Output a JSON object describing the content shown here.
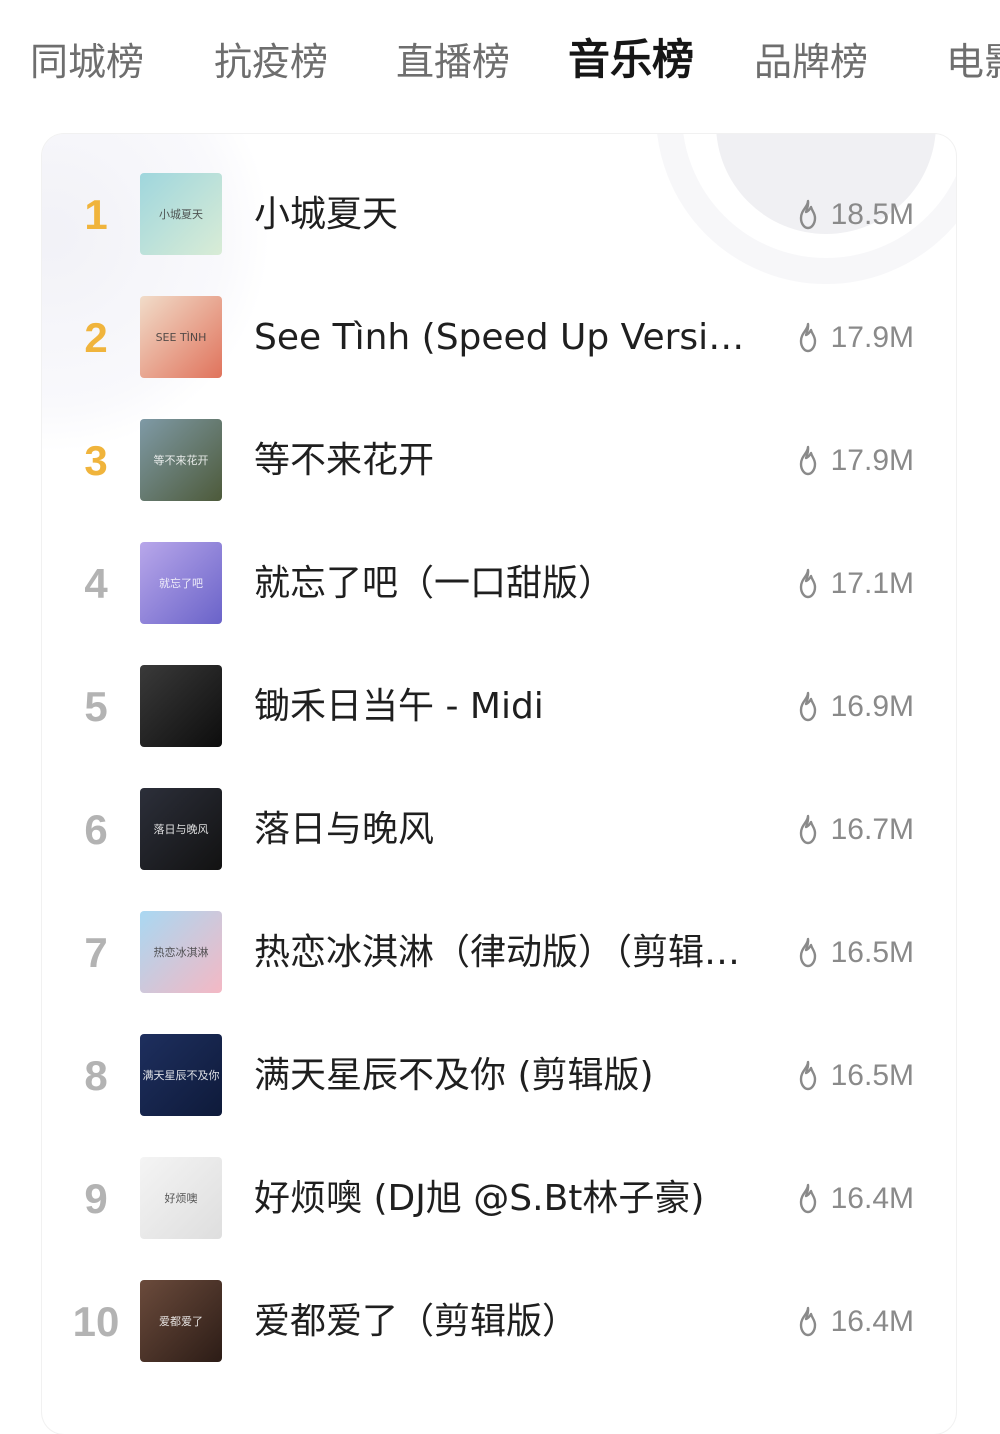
{
  "tabs": [
    {
      "label": "同城榜",
      "active": false
    },
    {
      "label": "抗疫榜",
      "active": false
    },
    {
      "label": "直播榜",
      "active": false
    },
    {
      "label": "音乐榜",
      "active": true
    },
    {
      "label": "品牌榜",
      "active": false
    },
    {
      "label": "电影",
      "active": false
    }
  ],
  "colors": {
    "rank_top": "#f0b43c",
    "rank_other": "#b3b3b3",
    "heat_text": "#8a8a8a",
    "title_text": "#1f1f1f"
  },
  "songs": [
    {
      "rank": "1",
      "title": "小城夏天",
      "heat": "18.5M",
      "cover": {
        "icon": "album-cover",
        "c1": "#9fd6dd",
        "c2": "#d9ecd6",
        "text": "小城夏天"
      }
    },
    {
      "rank": "2",
      "title": "See Tình (Speed Up Version)",
      "heat": "17.9M",
      "cover": {
        "icon": "album-cover",
        "c1": "#f1dcc9",
        "c2": "#e0735c",
        "text": "SEE TÌNH"
      }
    },
    {
      "rank": "3",
      "title": "等不来花开",
      "heat": "17.9M",
      "cover": {
        "icon": "album-cover",
        "c1": "#7f9aa6",
        "c2": "#4d5a3a",
        "text": "等不来花开"
      }
    },
    {
      "rank": "4",
      "title": "就忘了吧（一口甜版）",
      "heat": "17.1M",
      "cover": {
        "icon": "album-cover",
        "c1": "#b8a7ea",
        "c2": "#6a63c9",
        "text": "就忘了吧"
      }
    },
    {
      "rank": "5",
      "title": "锄禾日当午 - Midi",
      "heat": "16.9M",
      "cover": {
        "icon": "album-cover",
        "c1": "#3a3a3a",
        "c2": "#0d0d0d",
        "text": ""
      }
    },
    {
      "rank": "6",
      "title": "落日与晚风",
      "heat": "16.7M",
      "cover": {
        "icon": "album-cover",
        "c1": "#2c2f3a",
        "c2": "#121212",
        "text": "落日与晚风"
      }
    },
    {
      "rank": "7",
      "title": "热恋冰淇淋（律动版）（剪辑版）",
      "heat": "16.5M",
      "cover": {
        "icon": "album-cover",
        "c1": "#a9d8f2",
        "c2": "#f4b8c4",
        "text": "热恋冰淇淋"
      }
    },
    {
      "rank": "8",
      "title": "满天星辰不及你 (剪辑版)",
      "heat": "16.5M",
      "cover": {
        "icon": "album-cover",
        "c1": "#1e2f5e",
        "c2": "#0e1a3a",
        "text": "满天星辰不及你"
      }
    },
    {
      "rank": "9",
      "title": "好烦噢 (DJ旭 @S.Bt林子豪)",
      "heat": "16.4M",
      "cover": {
        "icon": "album-cover",
        "c1": "#f4f4f4",
        "c2": "#dedede",
        "text": "好烦噢"
      }
    },
    {
      "rank": "10",
      "title": "爱都爱了（剪辑版）",
      "heat": "16.4M",
      "cover": {
        "icon": "album-cover",
        "c1": "#6b4b3c",
        "c2": "#2c1c16",
        "text": "爱都爱了"
      }
    }
  ]
}
